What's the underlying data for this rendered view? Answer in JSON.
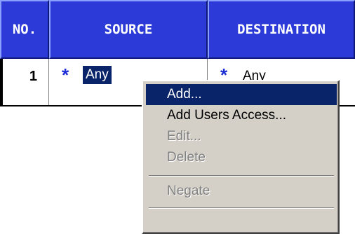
{
  "table": {
    "headers": {
      "no": "NO.",
      "source": "SOURCE",
      "destination": "DESTINATION"
    },
    "rows": [
      {
        "no": "1",
        "source": "Any",
        "destination": "Any",
        "source_icon": "star-icon",
        "destination_icon": "star-icon"
      }
    ],
    "star_glyph": "*"
  },
  "context_menu": {
    "items": [
      {
        "label": "Add...",
        "state": "highlighted"
      },
      {
        "label": "Add Users Access...",
        "state": "enabled"
      },
      {
        "label": "Edit...",
        "state": "disabled"
      },
      {
        "label": "Delete",
        "state": "disabled"
      },
      {
        "label": "Negate",
        "state": "disabled"
      }
    ]
  },
  "colors": {
    "header_bg": "#2c3ad8",
    "header_text": "#ffffff",
    "selection_bg": "#0a246a",
    "menu_bg": "#d4d0c8",
    "star": "#1b2bd6",
    "disabled_text": "#808080"
  }
}
